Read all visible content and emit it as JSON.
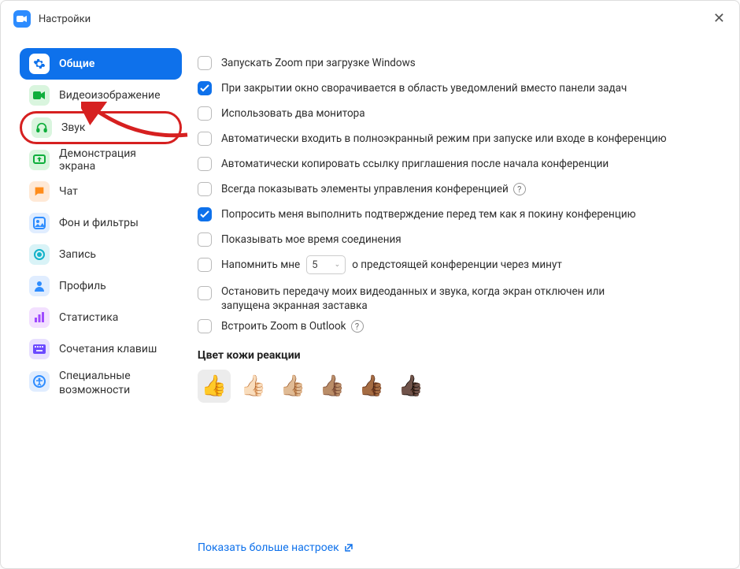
{
  "window": {
    "title": "Настройки"
  },
  "sidebar": {
    "items": [
      {
        "label": "Общие"
      },
      {
        "label": "Видеоизображение"
      },
      {
        "label": "Звук"
      },
      {
        "label": "Демонстрация экрана"
      },
      {
        "label": "Чат"
      },
      {
        "label": "Фон и фильтры"
      },
      {
        "label": "Запись"
      },
      {
        "label": "Профиль"
      },
      {
        "label": "Статистика"
      },
      {
        "label": "Сочетания клавиш"
      },
      {
        "label": "Специальные возможности"
      }
    ]
  },
  "options": {
    "o0": "Запускать Zoom при загрузке Windows",
    "o1": "При закрытии окно сворачивается в область уведомлений вместо панели задач",
    "o2": "Использовать два монитора",
    "o3": "Автоматически входить в полноэкранный режим при запуске или входе в конференцию",
    "o4": "Автоматически копировать ссылку приглашения после начала конференции",
    "o5": "Всегда показывать элементы управления конференцией",
    "o6": "Попросить меня выполнить подтверждение перед тем как я покину конференцию",
    "o7": "Показывать мое время соединения",
    "o8a": "Напомнить мне",
    "o8_value": "5",
    "o8b": "о предстоящей конференции через минут",
    "o9": "Остановить передачу моих видеоданных и звука, когда экран отключен или запущена экранная заставка",
    "o10": "Встроить Zoom в Outlook"
  },
  "reactions": {
    "title": "Цвет кожи реакции",
    "emoji": [
      "👍",
      "👍🏻",
      "👍🏼",
      "👍🏽",
      "👍🏾",
      "👍🏿"
    ]
  },
  "more": {
    "label": "Показать больше настроек"
  }
}
